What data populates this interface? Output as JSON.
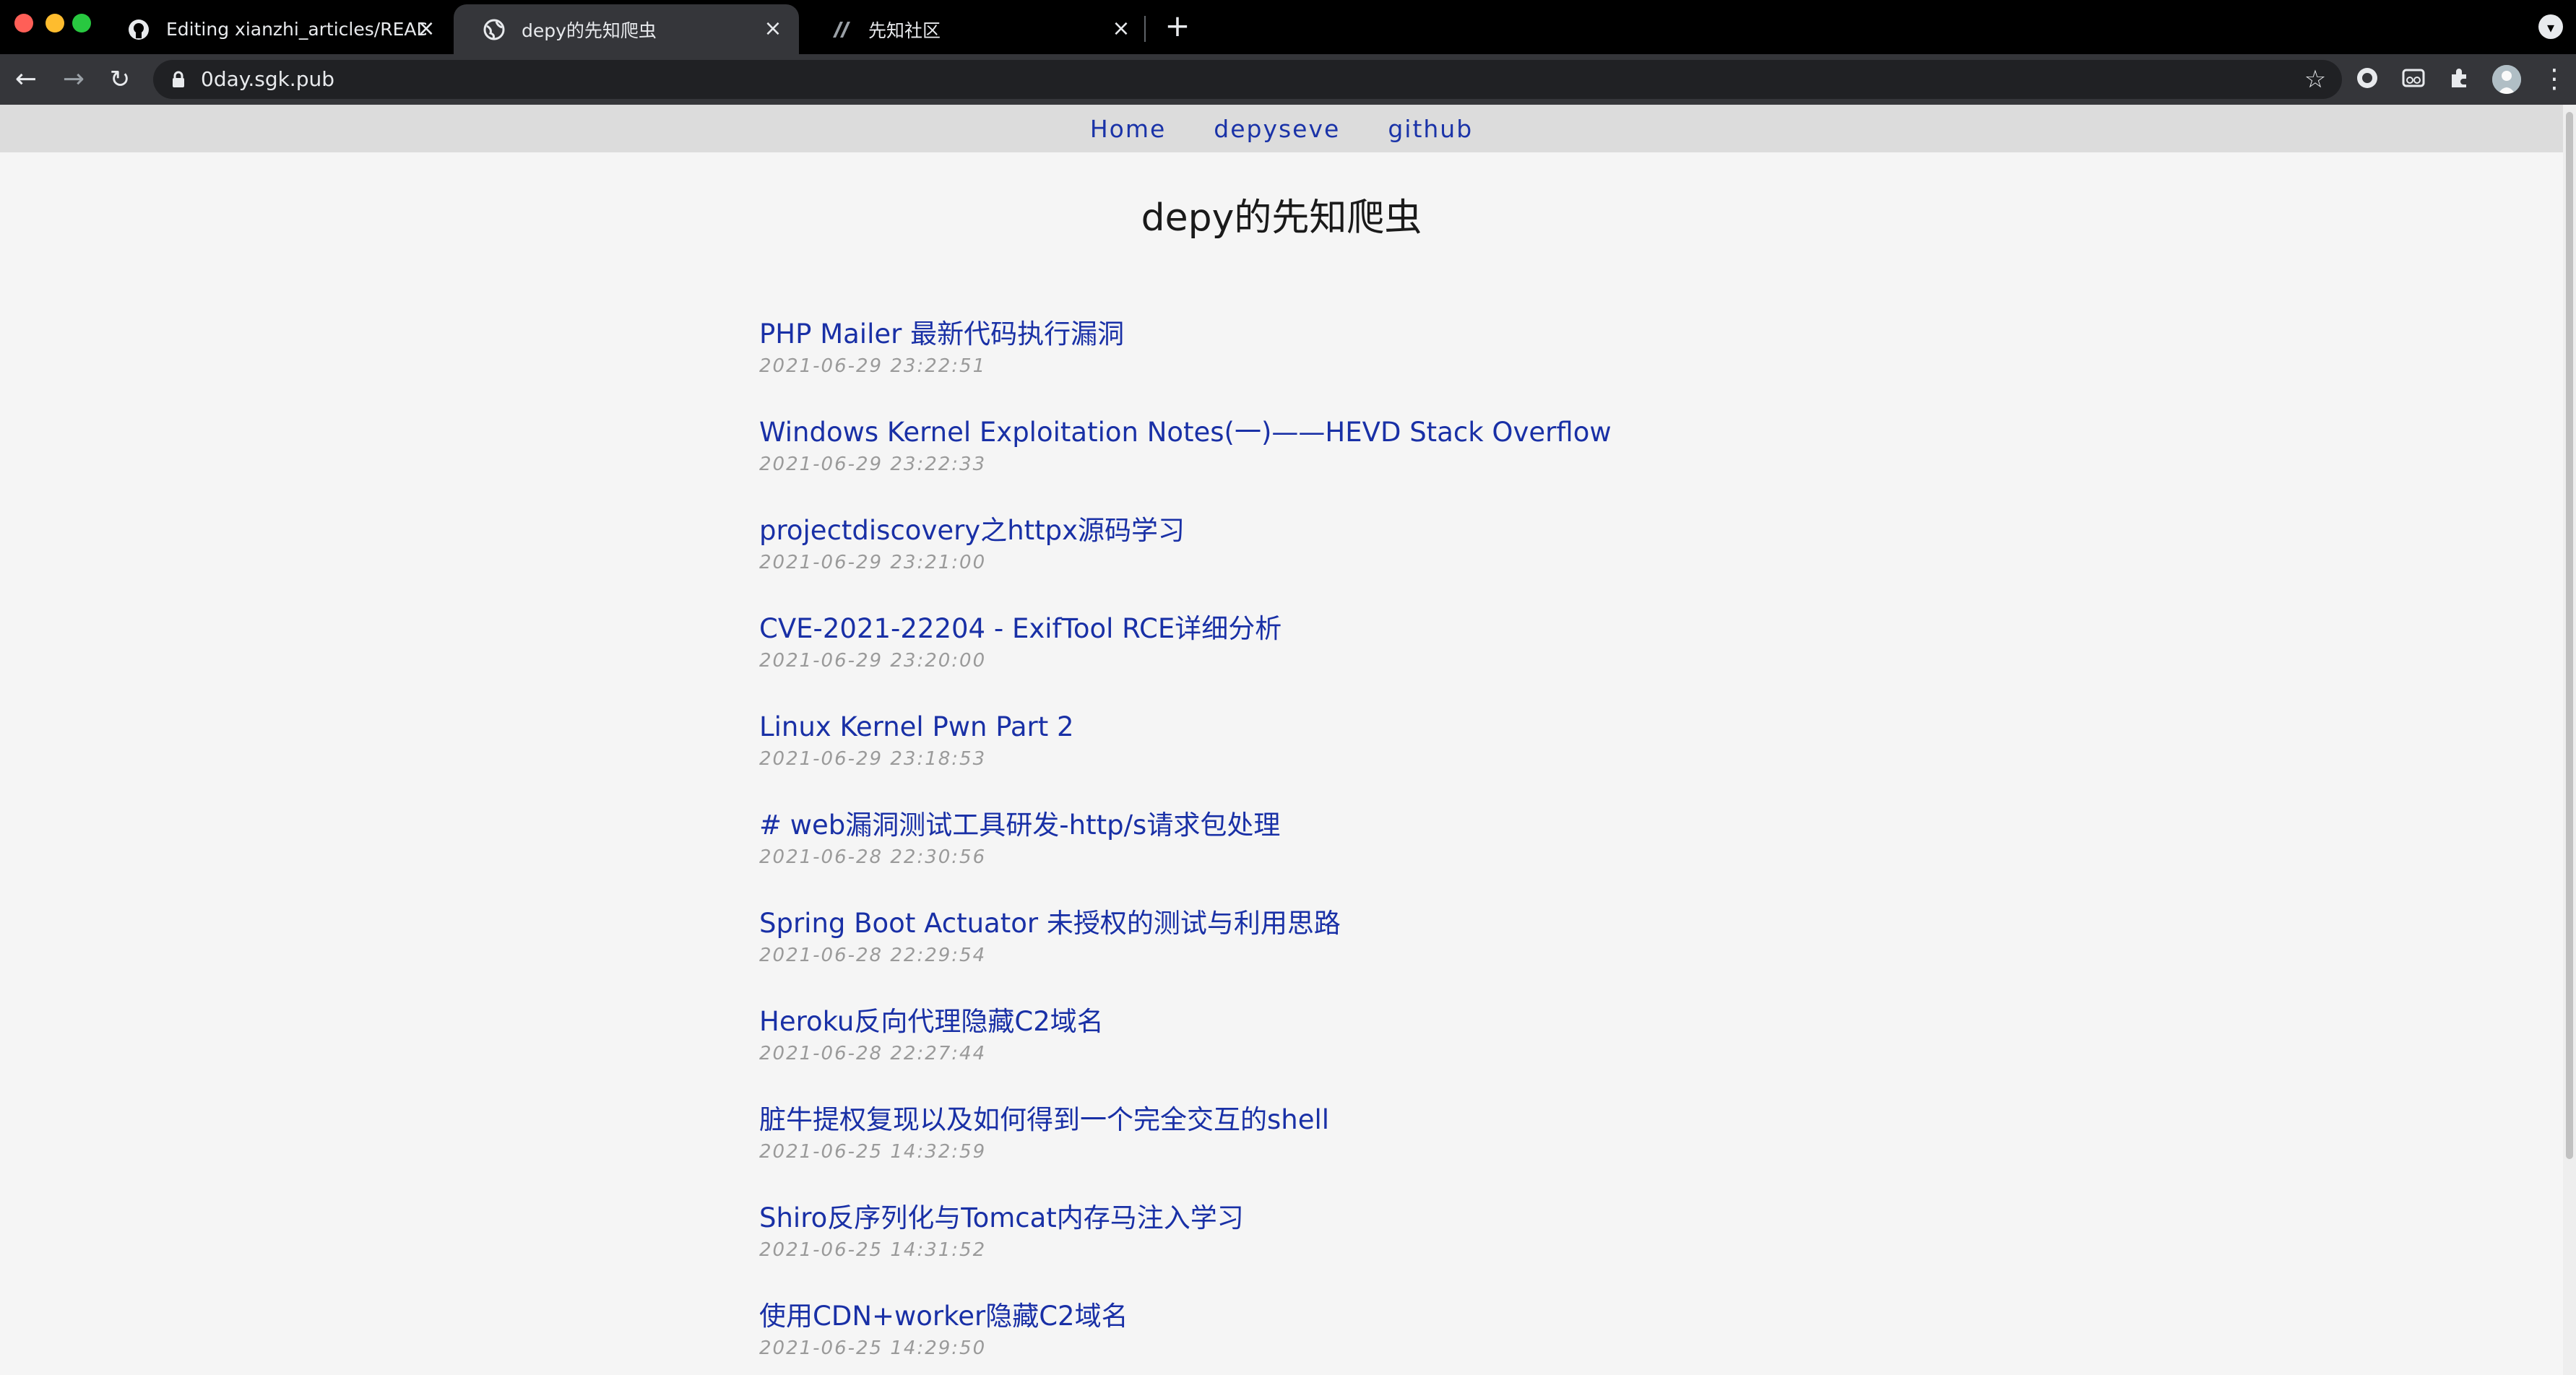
{
  "browser": {
    "tabs": [
      {
        "title": "Editing xianzhi_articles/README.md",
        "favicon": "github-icon",
        "active": false
      },
      {
        "title": "depy的先知爬虫",
        "favicon": "globe-icon",
        "active": true
      },
      {
        "title": "先知社区",
        "favicon": "xianzhi-icon",
        "active": false
      }
    ],
    "url": "0day.sgk.pub",
    "new_tab_glyph": "+",
    "colors": {
      "tabstrip": "#000000",
      "toolbar": "#35363a",
      "omnibox": "#202124"
    }
  },
  "site": {
    "nav": [
      {
        "label": "Home"
      },
      {
        "label": "depyseve"
      },
      {
        "label": "github"
      }
    ],
    "title": "depy的先知爬虫",
    "posts": [
      {
        "title": "PHP Mailer 最新代码执行漏洞",
        "date": "2021-06-29 23:22:51"
      },
      {
        "title": "Windows Kernel Exploitation Notes(一)——HEVD Stack Overflow",
        "date": "2021-06-29 23:22:33"
      },
      {
        "title": "projectdiscovery之httpx源码学习",
        "date": "2021-06-29 23:21:00"
      },
      {
        "title": "CVE-2021-22204 - ExifTool RCE详细分析",
        "date": "2021-06-29 23:20:00"
      },
      {
        "title": "Linux Kernel Pwn Part 2",
        "date": "2021-06-29 23:18:53"
      },
      {
        "title": "# web漏洞测试工具研发-http/s请求包处理",
        "date": "2021-06-28 22:30:56"
      },
      {
        "title": "Spring Boot Actuator 未授权的测试与利用思路",
        "date": "2021-06-28 22:29:54"
      },
      {
        "title": "Heroku反向代理隐藏C2域名",
        "date": "2021-06-28 22:27:44"
      },
      {
        "title": "脏牛提权复现以及如何得到一个完全交互的shell",
        "date": "2021-06-25 14:32:59"
      },
      {
        "title": "Shiro反序列化与Tomcat内存马注入学习",
        "date": "2021-06-25 14:31:52"
      },
      {
        "title": "使用CDN+worker隐藏C2域名",
        "date": "2021-06-25 14:29:50"
      }
    ],
    "colors": {
      "link": "#1930a6",
      "date": "#9a9a9a",
      "nav_bg": "#dcdcdc",
      "page_bg": "#f5f5f5"
    }
  }
}
